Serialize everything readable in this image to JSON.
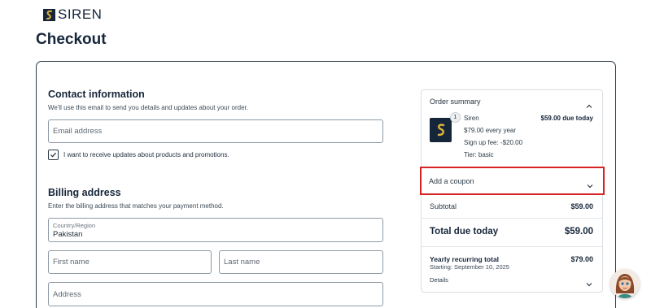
{
  "brand": {
    "name": "SIREN"
  },
  "page": {
    "title": "Checkout"
  },
  "contact": {
    "title": "Contact information",
    "description": "We'll use this email to send you details and updates about your order.",
    "email_placeholder": "Email address",
    "updates_label": "I want to receive updates about products and promotions.",
    "updates_checked": true
  },
  "billing": {
    "title": "Billing address",
    "description": "Enter the billing address that matches your payment method.",
    "country_label": "Country/Region",
    "country_value": "Pakistan",
    "first_name_placeholder": "First name",
    "last_name_placeholder": "Last name",
    "address_placeholder": "Address"
  },
  "summary": {
    "title": "Order summary",
    "product": {
      "quantity": "1",
      "name": "Siren",
      "price_due": "$59.00 due today",
      "recurring": "$79.00 every year",
      "signup_fee": "Sign up fee: -$20.00",
      "tier": "Tier: basic"
    },
    "coupon_label": "Add a coupon",
    "subtotal_label": "Subtotal",
    "subtotal_value": "$59.00",
    "total_label": "Total due today",
    "total_value": "$59.00",
    "yearly_label": "Yearly recurring total",
    "yearly_value": "$79.00",
    "yearly_start": "Starting: September 10, 2025",
    "details_label": "Details"
  },
  "icons": {
    "chevron_up": "chevron-up-icon",
    "chevron_down": "chevron-down-icon",
    "check": "check-icon"
  },
  "colors": {
    "brand_navy": "#16263a",
    "highlight_red": "#d62222",
    "logo_gold": "#e0b43a"
  }
}
